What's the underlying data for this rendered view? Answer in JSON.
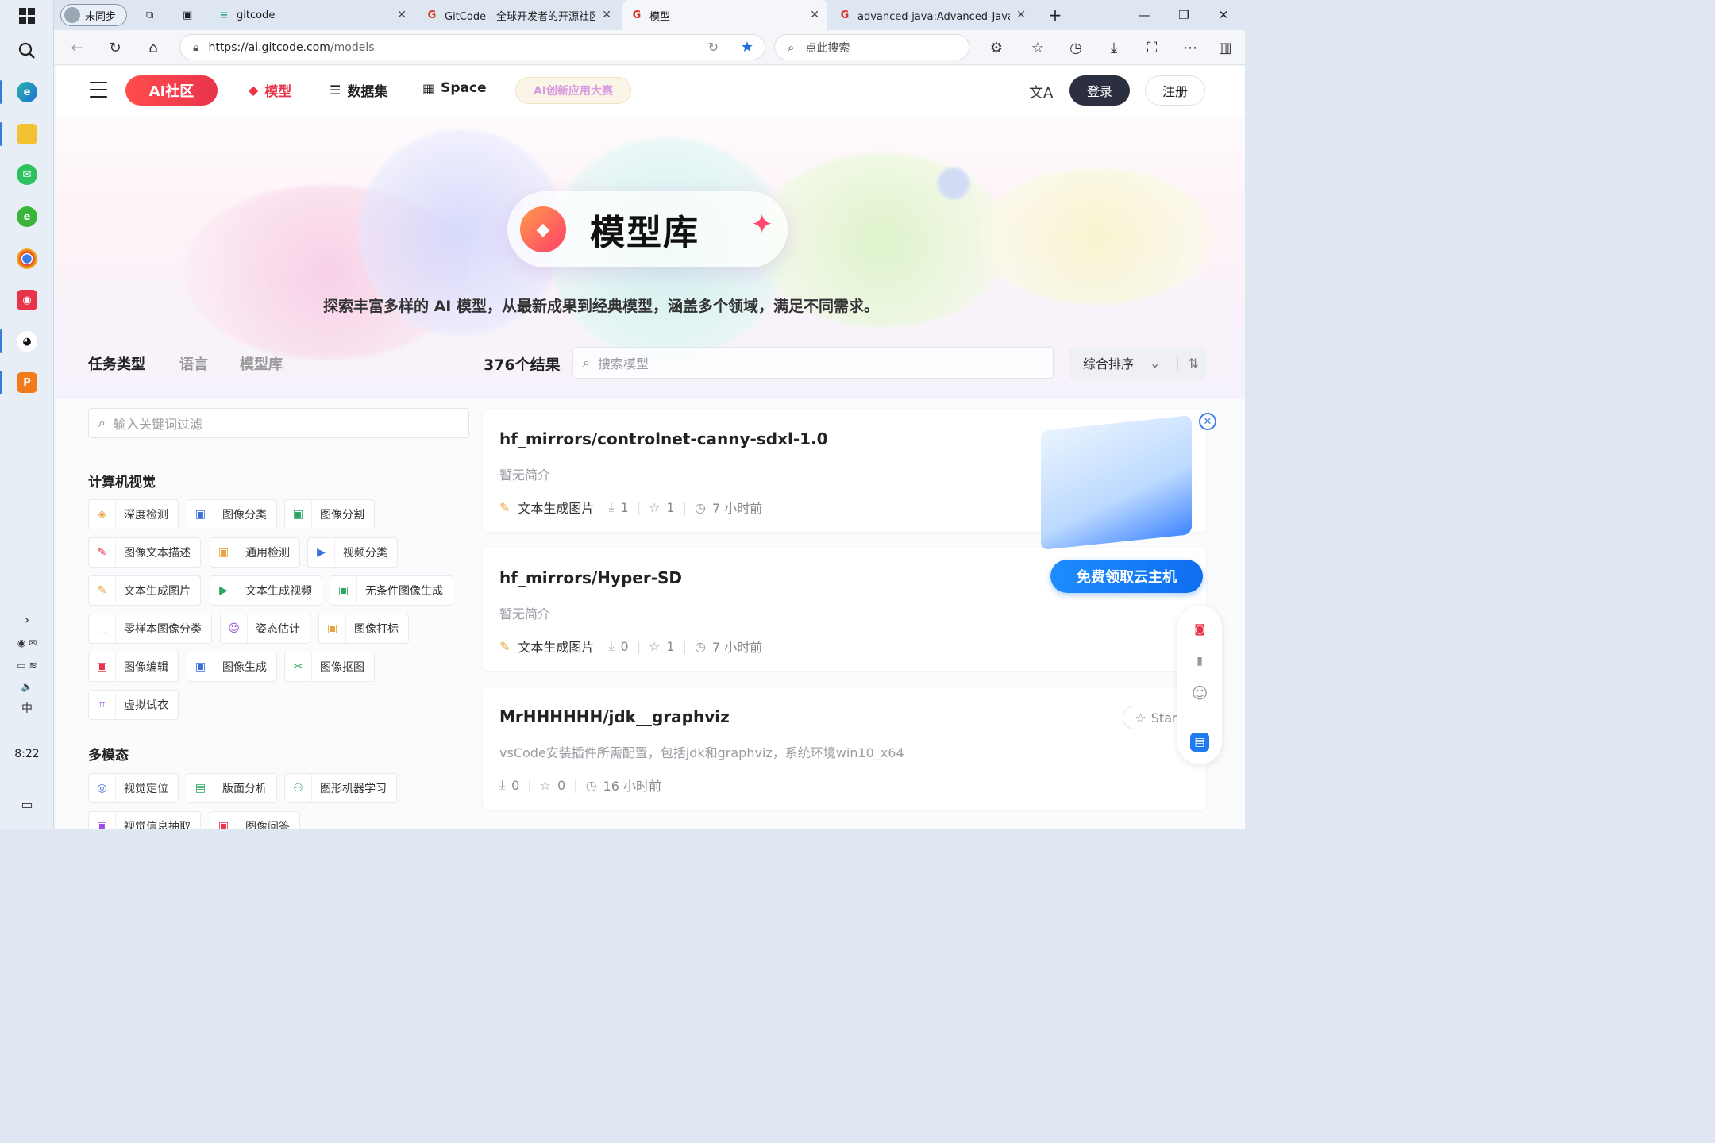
{
  "taskbar": {
    "clock": "8:22"
  },
  "browser": {
    "profile_label": "未同步",
    "tabs": [
      {
        "label": "gitcode"
      },
      {
        "label": "GitCode - 全球开发者的开源社区"
      },
      {
        "label": "模型"
      },
      {
        "label": "advanced-java:Advanced-Java是"
      }
    ],
    "url_domain": "https://ai.gitcode.com",
    "url_path": "/models",
    "search_placeholder": "点此搜索"
  },
  "site": {
    "logo": "AI社区",
    "nav": [
      {
        "label": "模型",
        "icon": "cube-icon"
      },
      {
        "label": "数据集",
        "icon": "database-icon"
      },
      {
        "label": "Space",
        "icon": "grid-icon"
      }
    ],
    "contest": "AI创新应用大赛",
    "login": "登录",
    "register": "注册"
  },
  "hero": {
    "title": "模型库",
    "subtitle": "探索丰富多样的 AI 模型，从最新成果到经典模型，涵盖多个领域，满足不同需求。"
  },
  "filters": {
    "tabs": [
      "任务类型",
      "语言",
      "模型库"
    ],
    "keyword_placeholder": "输入关键词过滤",
    "sections": [
      {
        "title": "计算机视觉",
        "chips": [
          "深度检测",
          "图像分类",
          "图像分割",
          "图像文本描述",
          "通用检测",
          "视频分类",
          "文本生成图片",
          "文本生成视频",
          "无条件图像生成",
          "零样本图像分类",
          "姿态估计",
          "图像打标",
          "图像编辑",
          "图像生成",
          "图像抠图",
          "虚拟试衣"
        ]
      },
      {
        "title": "多模态",
        "chips": [
          "视觉定位",
          "版面分析",
          "图形机器学习",
          "视觉信息抽取",
          "图像问答"
        ]
      }
    ]
  },
  "results": {
    "count": "376个结果",
    "search_placeholder": "搜索模型",
    "sort_label": "综合排序",
    "items": [
      {
        "title": "hf_mirrors/controlnet-canny-sdxl-1.0",
        "desc": "暂无简介",
        "tag": "文本生成图片",
        "downloads": "1",
        "stars": "1",
        "time": "7 小时前"
      },
      {
        "title": "hf_mirrors/Hyper-SD",
        "desc": "暂无简介",
        "tag": "文本生成图片",
        "downloads": "0",
        "stars": "1",
        "time": "7 小时前"
      },
      {
        "title": "MrHHHHHH/jdk__graphviz",
        "desc": "vsCode安装插件所需配置，包括jdk和graphviz，系统环境win10_x64",
        "tag": "",
        "downloads": "0",
        "stars": "0",
        "time": "16 小时前",
        "star_button": "Star"
      }
    ]
  },
  "promo": {
    "button": "免费领取云主机"
  }
}
